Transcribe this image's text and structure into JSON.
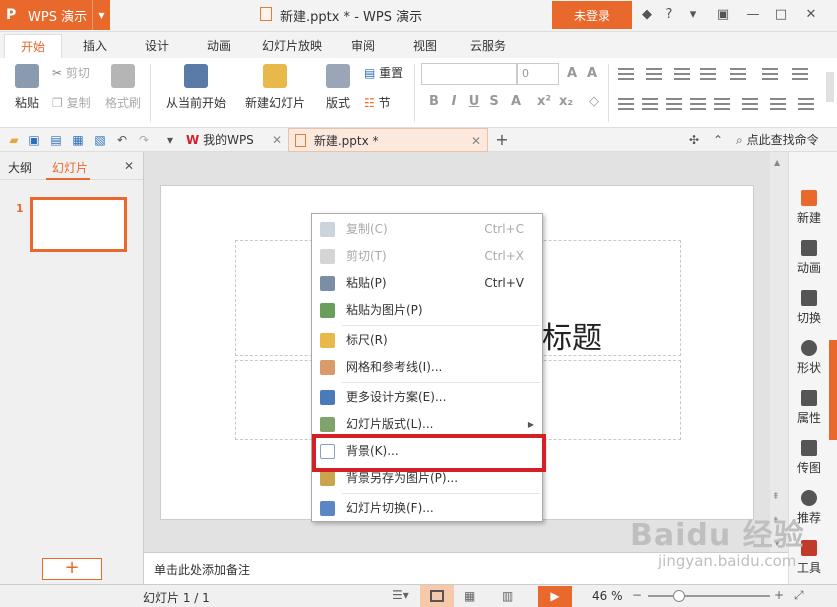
{
  "window": {
    "app_name": "WPS 演示",
    "title": "新建.pptx * - WPS 演示",
    "login_label": "未登录"
  },
  "ribbon_tabs": [
    "开始",
    "插入",
    "设计",
    "动画",
    "幻灯片放映",
    "审阅",
    "视图",
    "云服务"
  ],
  "ribbon": {
    "paste": "粘贴",
    "cut": "剪切",
    "copy": "复制",
    "format_painter": "格式刷",
    "from_current": "从当前开始",
    "new_slide": "新建幻灯片",
    "layout": "版式",
    "reset": "重置",
    "section": "节",
    "font_size_placeholder": "0"
  },
  "quickbar": {
    "tab_mywps": "我的WPS",
    "tab_doc": "新建.pptx *",
    "find_cmd": "点此查找命令"
  },
  "left_panel": {
    "tab_outline": "大纲",
    "tab_slides": "幻灯片",
    "slide_number": "1"
  },
  "slide": {
    "title_partial": "标题"
  },
  "right_sidebar": [
    "新建",
    "动画",
    "切换",
    "形状",
    "属性",
    "传图",
    "推荐",
    "工具"
  ],
  "context_menu": [
    {
      "label": "复制(C)",
      "shortcut": "Ctrl+C",
      "disabled": true
    },
    {
      "label": "剪切(T)",
      "shortcut": "Ctrl+X",
      "disabled": true
    },
    {
      "label": "粘贴(P)",
      "shortcut": "Ctrl+V",
      "disabled": false
    },
    {
      "label": "粘贴为图片(P)",
      "shortcut": "",
      "disabled": false
    },
    {
      "label": "标尺(R)",
      "shortcut": "",
      "disabled": false
    },
    {
      "label": "网格和参考线(I)...",
      "shortcut": "",
      "disabled": false
    },
    {
      "label": "更多设计方案(E)...",
      "shortcut": "",
      "disabled": false
    },
    {
      "label": "幻灯片版式(L)...",
      "shortcut": "",
      "disabled": false,
      "submenu": true
    },
    {
      "label": "背景(K)...",
      "shortcut": "",
      "disabled": false,
      "highlighted": true
    },
    {
      "label": "背景另存为图片(P)...",
      "shortcut": "",
      "disabled": false
    },
    {
      "label": "幻灯片切换(F)...",
      "shortcut": "",
      "disabled": false
    }
  ],
  "notes_placeholder": "单击此处添加备注",
  "status": {
    "slide_counter": "幻灯片 1 / 1",
    "zoom": "46 %"
  },
  "watermark": {
    "brand": "Baidu 经验",
    "url": "jingyan.baidu.com"
  },
  "colors": {
    "accent": "#e8692b",
    "highlight_box": "#d51f26"
  }
}
